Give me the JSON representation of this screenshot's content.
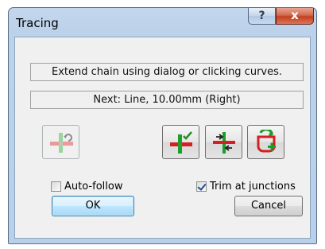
{
  "window": {
    "title": "Tracing",
    "help_glyph": "?",
    "close_glyph": "x"
  },
  "fields": {
    "instruction": "Extend chain using dialog or clicking curves.",
    "next": "Next: Line, 10.00mm (Right)"
  },
  "tools": [
    {
      "icon": "extend-undo-icon",
      "enabled": false
    },
    {
      "icon": "accept-extension-icon",
      "enabled": true
    },
    {
      "icon": "branch-arrows-icon",
      "enabled": true
    },
    {
      "icon": "close-chain-icon",
      "enabled": true
    }
  ],
  "options": {
    "auto_follow": {
      "label": "Auto-follow",
      "checked": false
    },
    "trim_at_junctions": {
      "label": "Trim at junctions",
      "checked": true
    }
  },
  "buttons": {
    "ok": "OK",
    "cancel": "Cancel"
  },
  "colors": {
    "accent_red": "#d42020",
    "accent_green": "#1a9e2c",
    "ok_button_border": "#3c7fb1"
  }
}
